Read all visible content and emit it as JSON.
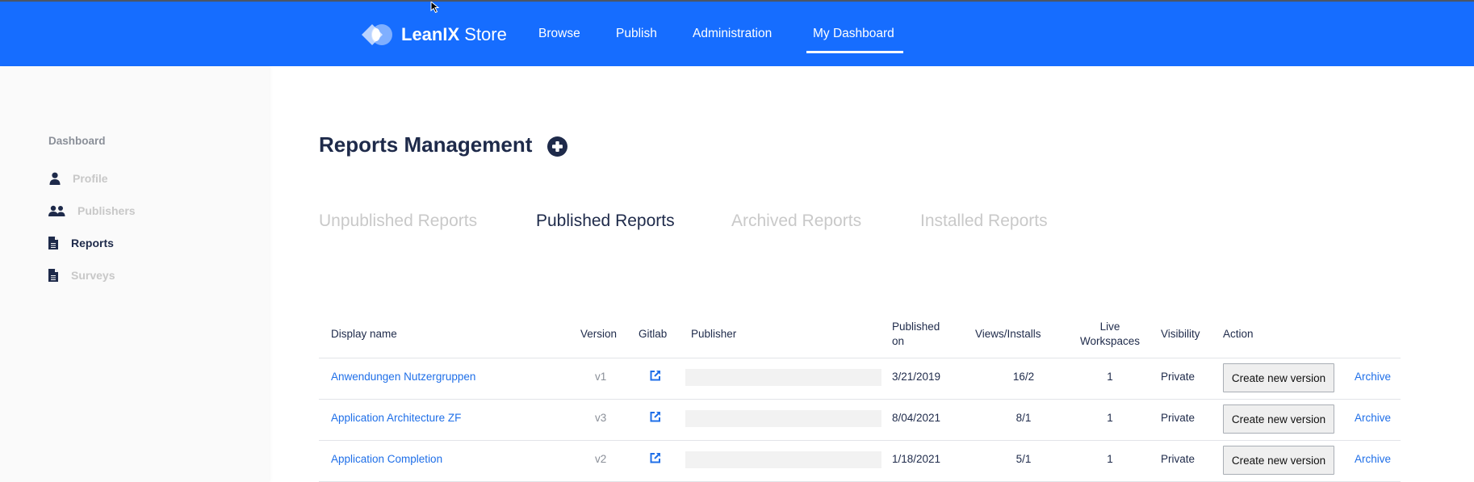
{
  "header": {
    "logo_bold": "LeanIX",
    "logo_light": "Store",
    "nav": [
      {
        "label": "Browse",
        "active": false
      },
      {
        "label": "Publish",
        "active": false
      },
      {
        "label": "Administration",
        "active": false
      },
      {
        "label": "My Dashboard",
        "active": true
      }
    ]
  },
  "sidebar": {
    "heading": "Dashboard",
    "items": [
      {
        "label": "Profile",
        "icon": "user-icon",
        "active": false
      },
      {
        "label": "Publishers",
        "icon": "users-icon",
        "active": false
      },
      {
        "label": "Reports",
        "icon": "file-icon",
        "active": true
      },
      {
        "label": "Surveys",
        "icon": "file-icon",
        "active": false
      }
    ]
  },
  "main": {
    "title": "Reports Management",
    "add_icon": "plus-circle-icon",
    "tabs": [
      {
        "label": "Unpublished Reports",
        "active": false
      },
      {
        "label": "Published Reports",
        "active": true
      },
      {
        "label": "Archived Reports",
        "active": false
      },
      {
        "label": "Installed Reports",
        "active": false
      }
    ],
    "table": {
      "columns": {
        "display_name": "Display name",
        "version": "Version",
        "gitlab": "Gitlab",
        "publisher": "Publisher",
        "published_on_1": "Published",
        "published_on_2": "on",
        "views_installs": "Views/Installs",
        "live_workspaces_1": "Live",
        "live_workspaces_2": "Workspaces",
        "visibility": "Visibility",
        "action": "Action"
      },
      "rows": [
        {
          "name": "Anwendungen Nutzergruppen",
          "version": "v1",
          "publisher": "",
          "published_on": "3/21/2019",
          "views_installs": "16/2",
          "live_workspaces": "1",
          "visibility": "Private",
          "create_label": "Create new version",
          "archive_label": "Archive"
        },
        {
          "name": "Application Architecture ZF",
          "version": "v3",
          "publisher": "",
          "published_on": "8/04/2021",
          "views_installs": "8/1",
          "live_workspaces": "1",
          "visibility": "Private",
          "create_label": "Create new version",
          "archive_label": "Archive"
        },
        {
          "name": "Application Completion",
          "version": "v2",
          "publisher": "",
          "published_on": "1/18/2021",
          "views_installs": "5/1",
          "live_workspaces": "1",
          "visibility": "Private",
          "create_label": "Create new version",
          "archive_label": "Archive"
        }
      ]
    }
  },
  "colors": {
    "brand": "#166dff",
    "link": "#1f6fe8",
    "text_dark": "#1e2a4a",
    "muted": "#c9c9c9"
  }
}
